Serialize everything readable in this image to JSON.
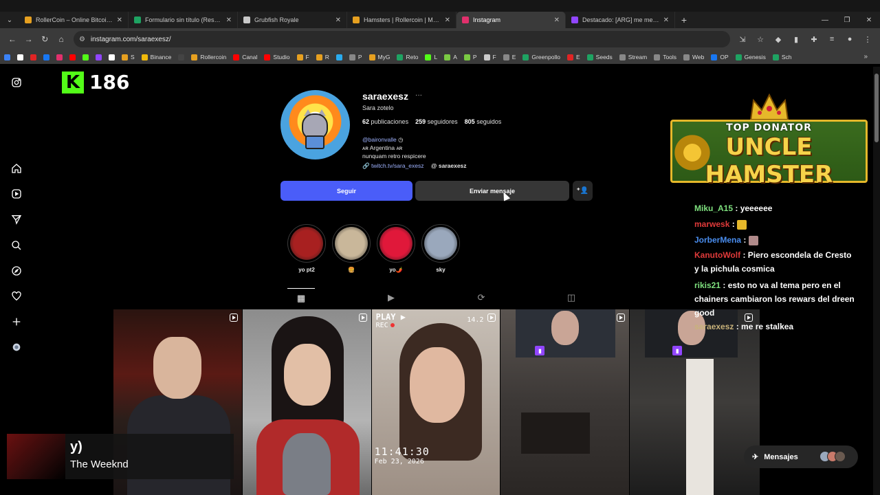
{
  "browser": {
    "tabs": [
      {
        "title": "RollerCoin – Online Bitcoin Mining",
        "favicon_color": "#e6a020",
        "active": false
      },
      {
        "title": "Formulario sin título (Respuestas)",
        "favicon_color": "#1ea362",
        "active": false
      },
      {
        "title": "Grubfish Royale",
        "favicon_color": "#c8c8c8",
        "active": false
      },
      {
        "title": "Hamsters | Rollercoin | Minar y",
        "favicon_color": "#e6a020",
        "active": false
      },
      {
        "title": "Instagram",
        "favicon_color": "#e1306c",
        "active": true
      },
      {
        "title": "Destacado: [ARG] me meti de",
        "favicon_color": "#9146ff",
        "active": false
      }
    ],
    "new_tab_symbol": "+",
    "url": "instagram.com/saraexesz/",
    "bookmarks": [
      {
        "label": "",
        "color": "#3b82f6"
      },
      {
        "label": "",
        "color": "#ffffff"
      },
      {
        "label": "",
        "color": "#e02424"
      },
      {
        "label": "",
        "color": "#1877f2"
      },
      {
        "label": "",
        "color": "#e1306c"
      },
      {
        "label": "",
        "color": "#ff0000"
      },
      {
        "label": "",
        "color": "#53fc18"
      },
      {
        "label": "",
        "color": "#9146ff"
      },
      {
        "label": "",
        "color": "#ffffff"
      },
      {
        "label": "S",
        "color": "#e6a020"
      },
      {
        "label": "Binance",
        "color": "#f0b90b"
      },
      {
        "label": "",
        "color": "#444444"
      },
      {
        "label": "Rollercoin",
        "color": "#e6a020"
      },
      {
        "label": "Canal",
        "color": "#ff0000"
      },
      {
        "label": "Studio",
        "color": "#ff0000"
      },
      {
        "label": "F",
        "color": "#e6a020"
      },
      {
        "label": "R",
        "color": "#e6a020"
      },
      {
        "label": "",
        "color": "#2aabee"
      },
      {
        "label": "P",
        "color": "#888888"
      },
      {
        "label": "MyG",
        "color": "#e6a020"
      },
      {
        "label": "Reto",
        "color": "#1ea362"
      },
      {
        "label": "L",
        "color": "#53fc18"
      },
      {
        "label": "A",
        "color": "#7ac943"
      },
      {
        "label": "P",
        "color": "#7ac943"
      },
      {
        "label": "F",
        "color": "#cccccc"
      },
      {
        "label": "E",
        "color": "#888888"
      },
      {
        "label": "Greenpollo",
        "color": "#1ea362"
      },
      {
        "label": "E",
        "color": "#e02424"
      },
      {
        "label": "Seeds",
        "color": "#1ea362"
      },
      {
        "label": "Stream",
        "color": "#888888"
      },
      {
        "label": "Tools",
        "color": "#888888"
      },
      {
        "label": "Web",
        "color": "#888888"
      },
      {
        "label": "OP",
        "color": "#1877f2"
      },
      {
        "label": "Genesis",
        "color": "#1ea362"
      },
      {
        "label": "Sch",
        "color": "#1ea362"
      }
    ]
  },
  "profile": {
    "username": "saraexesz",
    "more": "···",
    "full_name": "Sara zotelo",
    "posts_count": "62",
    "posts_label": "publicaciones",
    "followers_count": "259",
    "followers_label": "seguidores",
    "following_count": "805",
    "following_label": "seguidos",
    "bio_mention": "@baironvalle",
    "bio_line2": "ᴀʀ Argentina ᴀʀ",
    "bio_line3": "nunquam retro respicere",
    "link": "twitch.tv/sara_exesz",
    "threads_handle": "saraexesz",
    "follow_label": "Seguir",
    "message_label": "Enviar mensaje",
    "highlights": [
      {
        "label": "yo pt2",
        "color": "#a82020"
      },
      {
        "label": "🍔",
        "color": "#c9b79a"
      },
      {
        "label": "yo🌶️",
        "color": "#e0183a"
      },
      {
        "label": "sky",
        "color": "#9aa8bc"
      }
    ]
  },
  "overlay": {
    "kick_letter": "K",
    "kick_count": "186",
    "donator_line1": "TOP DONATOR",
    "donator_line2": "UNCLE HAMSTER",
    "chat": [
      {
        "user": "Miku_A15",
        "text": " : yeeeeee",
        "user_color": "#7ee07e"
      },
      {
        "user": "marwesk",
        "text": " : ",
        "user_color": "#e03a3a"
      },
      {
        "user": "JorberMena",
        "text": " : ",
        "user_color": "#4a8ef0"
      },
      {
        "user": "KanutoWolf",
        "text": " : Piero escondela de Cresto y la pichula cosmica",
        "user_color": "#e03a3a"
      },
      {
        "user": "rikis21",
        "text": " : esto no va al tema pero en el chainers cambiaron los rewars del dreen good",
        "user_color": "#7ee07e"
      },
      {
        "user": "saraexesz",
        "text": " : me re stalkea",
        "user_color": "#c8b27a"
      }
    ],
    "music_track": "y)",
    "music_artist": "The Weeknd",
    "posts_overlay": {
      "play": "PLAY ▶",
      "rec": "REC",
      "corner": "14.2",
      "time": "11:41:30",
      "date": "Feb 23, 2026"
    }
  },
  "messages_pill": {
    "label": "Mensajes"
  }
}
